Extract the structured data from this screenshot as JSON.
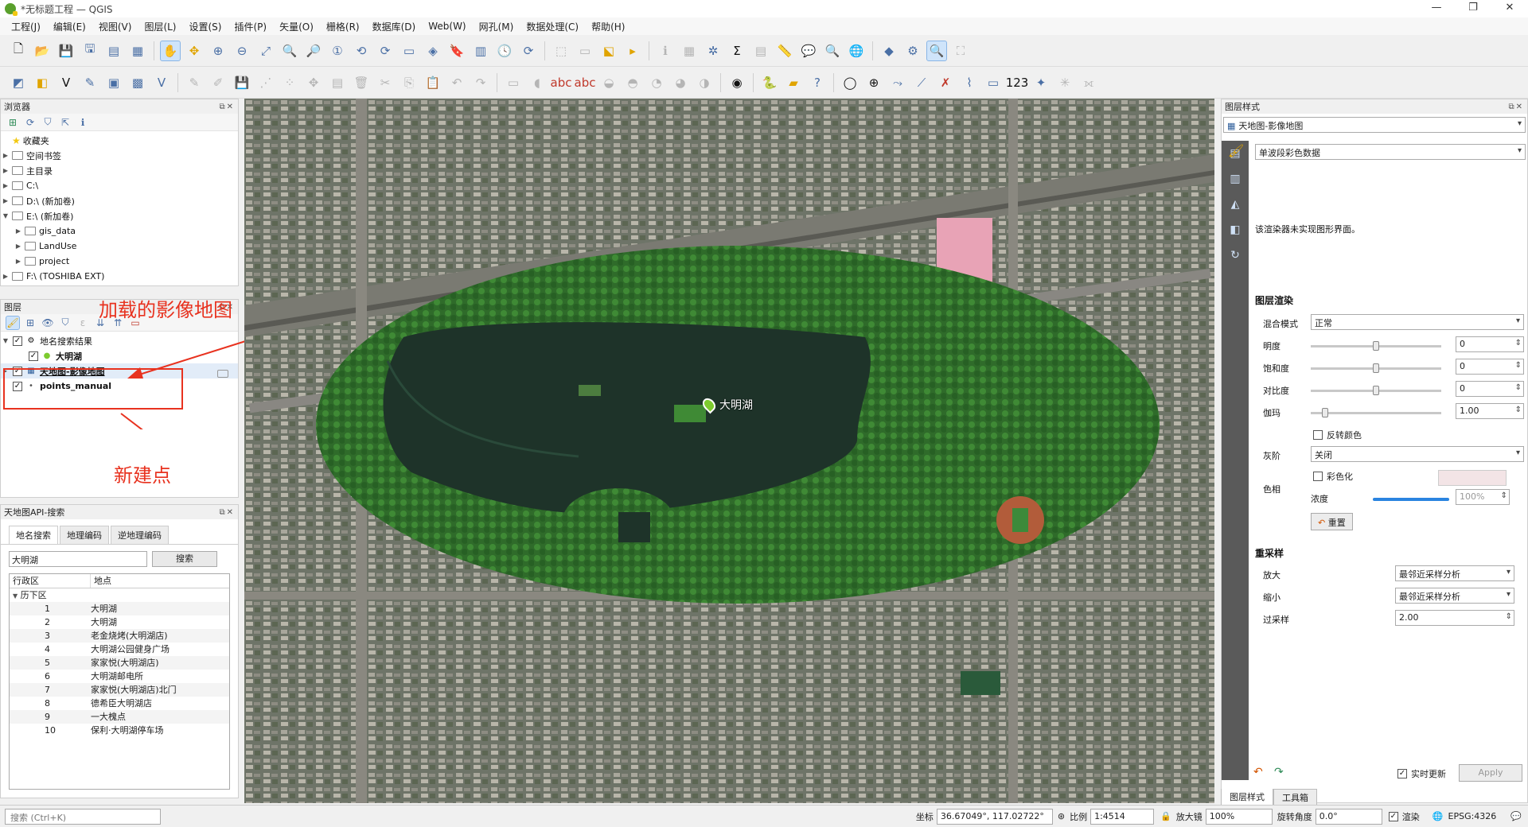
{
  "window": {
    "title": "*无标题工程 — QGIS",
    "controls": [
      "—",
      "❐",
      "✕"
    ]
  },
  "menu": [
    "工程(J)",
    "编辑(E)",
    "视图(V)",
    "图层(L)",
    "设置(S)",
    "插件(P)",
    "矢量(O)",
    "栅格(R)",
    "数据库(D)",
    "Web(W)",
    "网孔(M)",
    "数据处理(C)",
    "帮助(H)"
  ],
  "browser": {
    "title": "浏览器",
    "items": [
      {
        "label": "收藏夹",
        "icon": "star-icon"
      },
      {
        "label": "空间书签",
        "icon": "folder-icon"
      },
      {
        "label": "主目录",
        "icon": "folder-icon"
      },
      {
        "label": "C:\\",
        "icon": "folder-icon"
      },
      {
        "label": "D:\\ (新加卷)",
        "icon": "folder-icon"
      },
      {
        "label": "E:\\ (新加卷)",
        "icon": "folder-icon"
      },
      {
        "label": "gis_data",
        "icon": "folder-icon"
      },
      {
        "label": "LandUse",
        "icon": "folder-icon"
      },
      {
        "label": "project",
        "icon": "folder-icon"
      },
      {
        "label": "F:\\ (TOSHIBA EXT)",
        "icon": "folder-icon"
      }
    ]
  },
  "layers": {
    "title": "图层",
    "items": [
      {
        "label": "地名搜索结果",
        "checked": true,
        "level": 0
      },
      {
        "label": "大明湖",
        "checked": true,
        "level": 1
      },
      {
        "label": "天地图-影像地图",
        "checked": true,
        "level": 0
      },
      {
        "label": "points_manual",
        "checked": true,
        "level": 0
      }
    ]
  },
  "annotations": {
    "loaded_map": "加载的影像地图",
    "new_point": "新建点"
  },
  "search_panel": {
    "title": "天地图API-搜索",
    "tabs": [
      "地名搜索",
      "地理编码",
      "逆地理编码"
    ],
    "query": "大明湖",
    "search_button": "搜索",
    "columns": [
      "行政区",
      "地点"
    ],
    "group": "历下区",
    "results": [
      {
        "n": "1",
        "place": "大明湖"
      },
      {
        "n": "2",
        "place": "大明湖"
      },
      {
        "n": "3",
        "place": "老金烧烤(大明湖店)"
      },
      {
        "n": "4",
        "place": "大明湖公园健身广场"
      },
      {
        "n": "5",
        "place": "家家悦(大明湖店)"
      },
      {
        "n": "6",
        "place": "大明湖邮电所"
      },
      {
        "n": "7",
        "place": "家家悦(大明湖店)北门"
      },
      {
        "n": "8",
        "place": "德希臣大明湖店"
      },
      {
        "n": "9",
        "place": "一大槐点"
      },
      {
        "n": "10",
        "place": "保利·大明湖停车场"
      }
    ]
  },
  "map": {
    "marker_label": "大明湖"
  },
  "style_panel": {
    "title": "图层样式",
    "layer": "天地图-影像地图",
    "renderer": "单波段彩色数据",
    "renderer_msg": "该渲染器未实现图形界面。",
    "render_section": "图层渲染",
    "blend_label": "混合模式",
    "blend_value": "正常",
    "brightness_label": "明度",
    "brightness": "0",
    "saturation_label": "饱和度",
    "saturation": "0",
    "contrast_label": "对比度",
    "contrast": "0",
    "gamma_label": "伽玛",
    "gamma": "1.00",
    "invert_label": "反转颜色",
    "grayscale_label": "灰阶",
    "grayscale_value": "关闭",
    "hue_label": "色相",
    "colorize_label": "彩色化",
    "strength_label": "浓度",
    "strength": "100%",
    "reset_label": "重置",
    "resample_section": "重采样",
    "zoomin_label": "放大",
    "zoomin_value": "最邻近采样分析",
    "zoomout_label": "缩小",
    "zoomout_value": "最邻近采样分析",
    "oversample_label": "过采样",
    "oversample": "2.00",
    "live_update_label": "实时更新",
    "apply_label": "Apply",
    "bottom_tabs": [
      "图层样式",
      "工具箱"
    ]
  },
  "status": {
    "locator_placeholder": "搜索 (Ctrl+K)",
    "coord_label": "坐标",
    "coord_value": "36.67049°, 117.02722°",
    "scale_label": "比例",
    "scale_value": "1:4514",
    "magnifier_label": "放大镜",
    "magnifier_value": "100%",
    "rotation_label": "旋转角度",
    "rotation_value": "0.0°",
    "render_label": "渲染",
    "crs": "EPSG:4326"
  }
}
